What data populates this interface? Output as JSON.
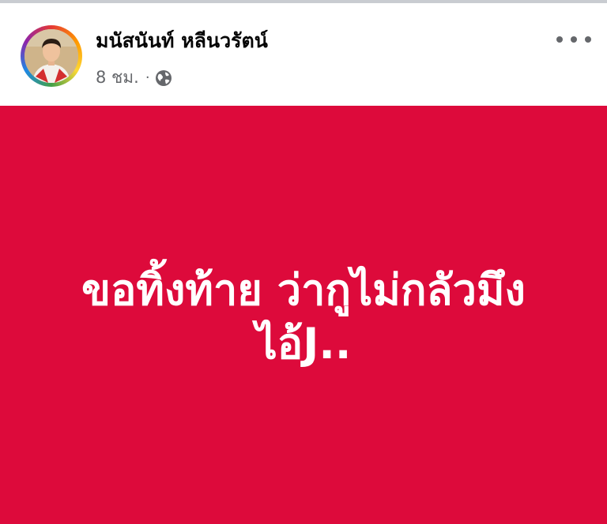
{
  "post": {
    "author": "มนัสนันท์ หลีนวรัตน์",
    "time": "8 ชม.",
    "separator": "·",
    "privacy_icon": "globe-icon",
    "more_icon": "more-horizontal-icon",
    "body_lines": [
      "ขอทิ้งท้าย ว่ากูไม่กลัวมึง",
      "ไอ้J.."
    ],
    "background_color": "#dd0a3b",
    "text_color": "#ffffff"
  }
}
